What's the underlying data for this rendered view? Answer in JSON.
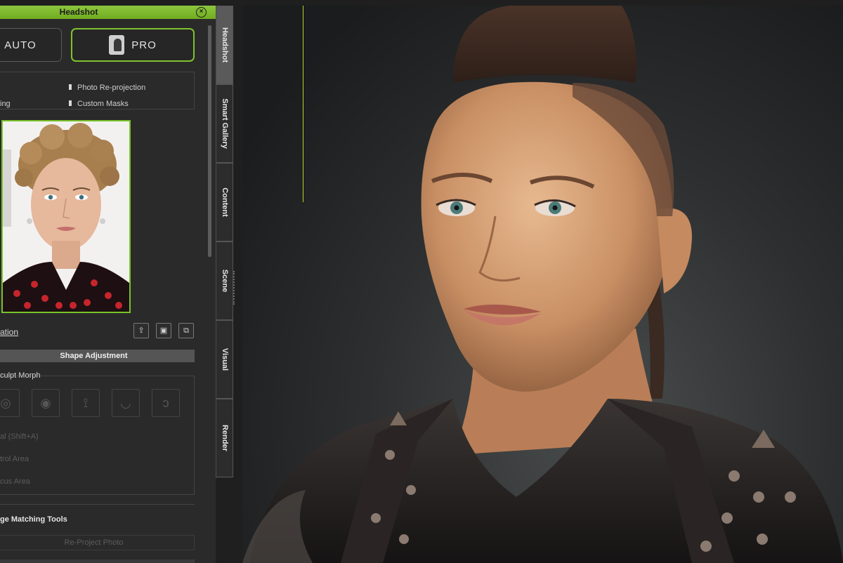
{
  "panel": {
    "title": "Headshot",
    "close_icon": "close-circle-icon",
    "modes": {
      "auto": "AUTO",
      "pro": "PRO"
    },
    "options": [
      {
        "label": "Photo Re-projection"
      },
      {
        "label": "ing"
      },
      {
        "label": "Custom Masks"
      }
    ],
    "photo_label": "ation",
    "section_header": "Shape Adjustment",
    "sculpt_label": "culpt Morph",
    "sculpt_icons": [
      "face-icon",
      "eye-icon",
      "nose-icon",
      "lips-icon",
      "ear-icon"
    ],
    "dim_rows": [
      "al (Shift+A)",
      "trol Area",
      "cus Area"
    ],
    "matching_label": "ge Matching Tools",
    "reproject_button": "Re-Project Photo"
  },
  "tabs": [
    "Headshot",
    "Smart Gallery",
    "Content",
    "Scene",
    "Visual",
    "Render"
  ],
  "colors": {
    "accent": "#80c22f",
    "title_bar": "#7fb92f"
  }
}
